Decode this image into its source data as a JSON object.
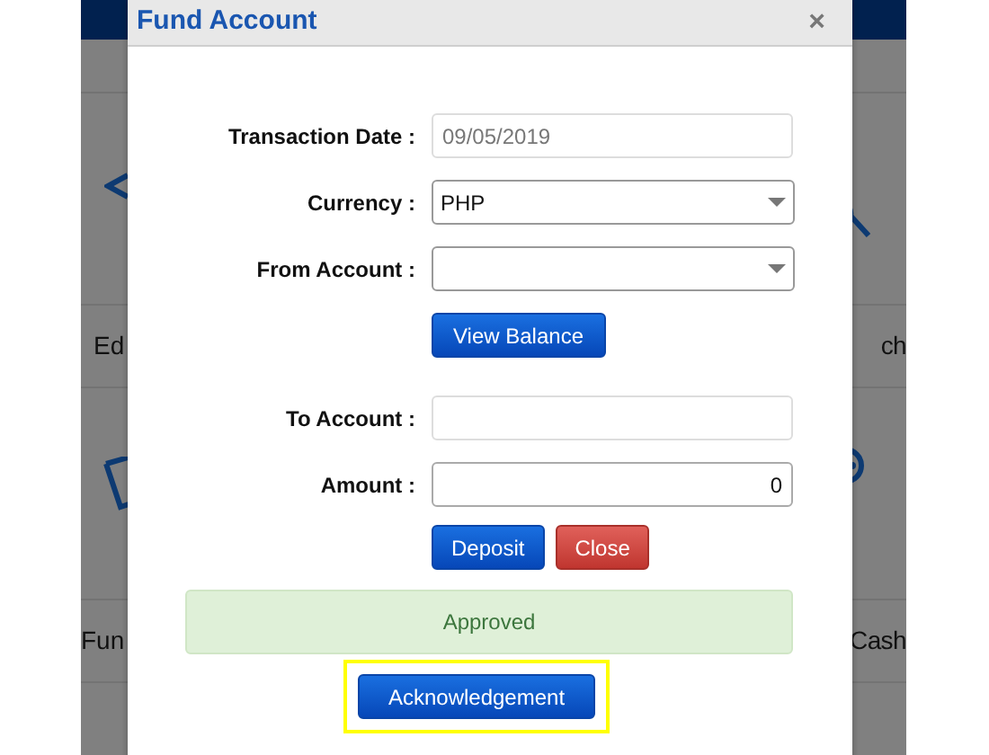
{
  "background": {
    "rows": [
      {
        "left": "Ed",
        "right": "ch"
      },
      {
        "left": "Fun",
        "right": "Cash"
      }
    ]
  },
  "modal": {
    "title": "Fund Account",
    "close": "×",
    "fields": [
      {
        "kind": "input",
        "label": "Transaction Date :",
        "value": "09/05/2019",
        "disabled": true
      },
      {
        "kind": "select",
        "label": "Currency :",
        "value": "PHP"
      },
      {
        "kind": "select",
        "label": "From Account :"
      },
      {
        "kind": "button",
        "label": "View Balance"
      },
      {
        "kind": "input",
        "label": "To Account :",
        "disabled": true
      },
      {
        "kind": "input",
        "label": "Amount :",
        "value": "0",
        "numeric": true,
        "disabled": false
      }
    ],
    "buttons": [
      {
        "label": "Deposit",
        "kind": "primary"
      },
      {
        "label": "Close",
        "kind": "danger"
      }
    ],
    "alert": "Approved",
    "acknowledgement": {
      "label": "Acknowledgement",
      "highlighted": true
    }
  }
}
